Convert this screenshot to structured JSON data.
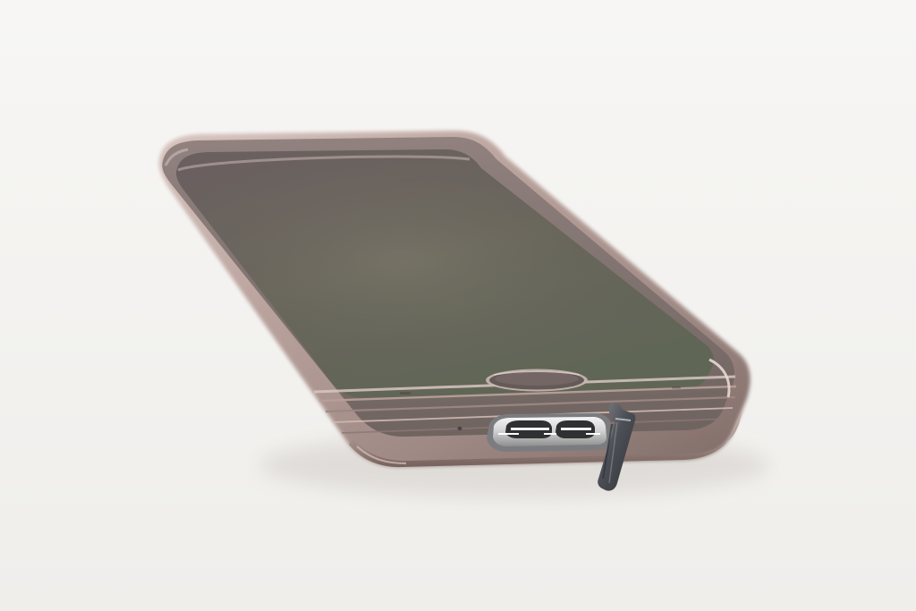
{
  "image": {
    "subject": "smartphone-with-open-usb-port-cover",
    "colors": {
      "background": "#f4f3f1",
      "phone_frame": "#b59a93",
      "phone_frame_dark": "#7e6964",
      "screen_top": "#6c6160",
      "screen_mid": "#676356",
      "screen_bottom": "#5e6555",
      "port_metal": "#d8d8d8",
      "port_inner": "#2c2c2c",
      "flap": "#4b4d52"
    },
    "icons": [
      "phone-icon",
      "home-button-icon",
      "usb-port-icon",
      "usb-flap-icon",
      "microphone-hole-icon"
    ]
  }
}
